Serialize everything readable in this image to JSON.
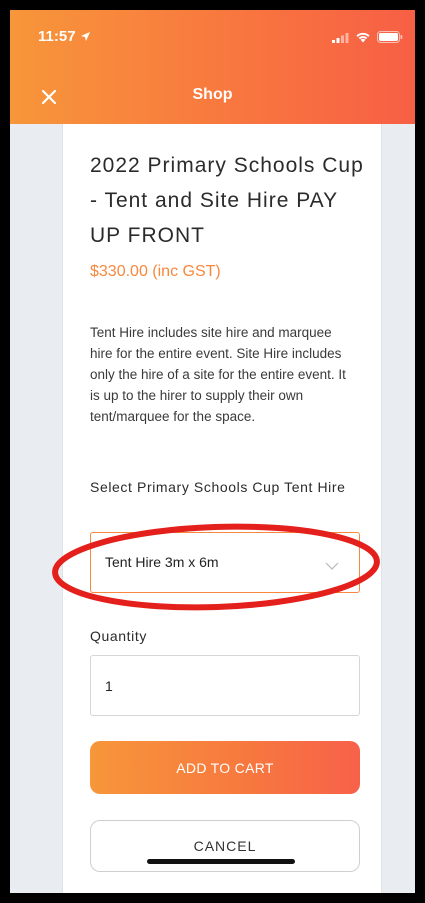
{
  "status_bar": {
    "time": "11:57"
  },
  "header": {
    "title": "Shop",
    "close_icon": "close-icon"
  },
  "product": {
    "title": "2022 Primary Schools Cup - Tent and Site Hire PAY UP FRONT",
    "price": "$330.00 (inc GST)",
    "description": "Tent Hire includes site hire and marquee hire for the entire event. Site Hire includes only the hire of a site for the entire event. It is up to the hirer to supply their own tent/marquee for the space."
  },
  "options": {
    "label": "Select Primary Schools Cup Tent Hire",
    "selected": "Tent Hire 3m x 6m"
  },
  "quantity": {
    "label": "Quantity",
    "value": "1"
  },
  "actions": {
    "add_to_cart": "ADD TO CART",
    "cancel": "CANCEL"
  },
  "colors": {
    "accent": "#f7883d",
    "header_gradient_end": "#f75f45",
    "annotation": "#e3201b"
  }
}
